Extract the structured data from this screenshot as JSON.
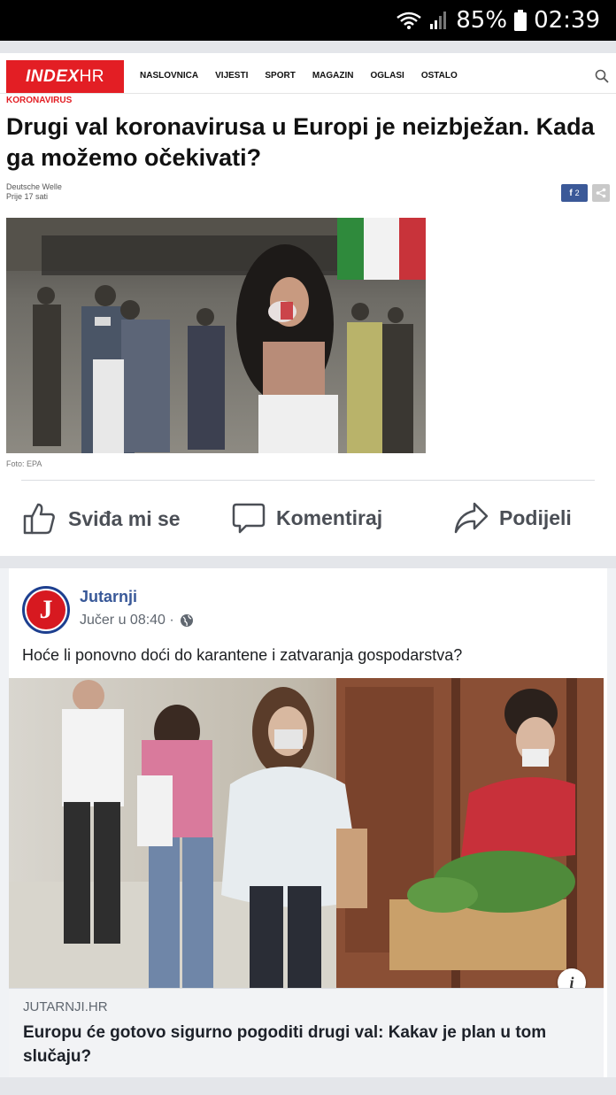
{
  "status_bar": {
    "battery": "85%",
    "time": "02:39"
  },
  "index_article": {
    "logo": {
      "brand": "INDEX",
      "suffix": "HR"
    },
    "nav": [
      "NASLOVNICA",
      "VIJESTI",
      "SPORT",
      "MAGAZIN",
      "OGLASI",
      "OSTALO"
    ],
    "kicker": "KORONAVIRUS",
    "headline": "Drugi val koronavirusa u Europi je neizbježan. Kada ga možemo očekivati?",
    "source": "Deutsche Welle",
    "time": "Prije 17 sati",
    "facebook_count": "2",
    "photo_caption": "Foto: EPA"
  },
  "actions": {
    "like": "Sviđa mi se",
    "comment": "Komentiraj",
    "share": "Podijeli"
  },
  "jutarnji_post": {
    "avatar_letter": "J",
    "page_name": "Jutarnji",
    "post_time": "Jučer u 08:40 ·",
    "text": "Hoće li ponovno doći do karantene i zatvaranja gospodarstva?",
    "info_icon": "i",
    "link_domain": "JUTARNJI.HR",
    "link_title": "Europu će gotovo sigurno pogoditi drugi val: Kakav je plan u tom slučaju?"
  },
  "colors": {
    "index_red": "#e31e24",
    "facebook_blue": "#3b5998",
    "page_name_blue": "#385898"
  }
}
